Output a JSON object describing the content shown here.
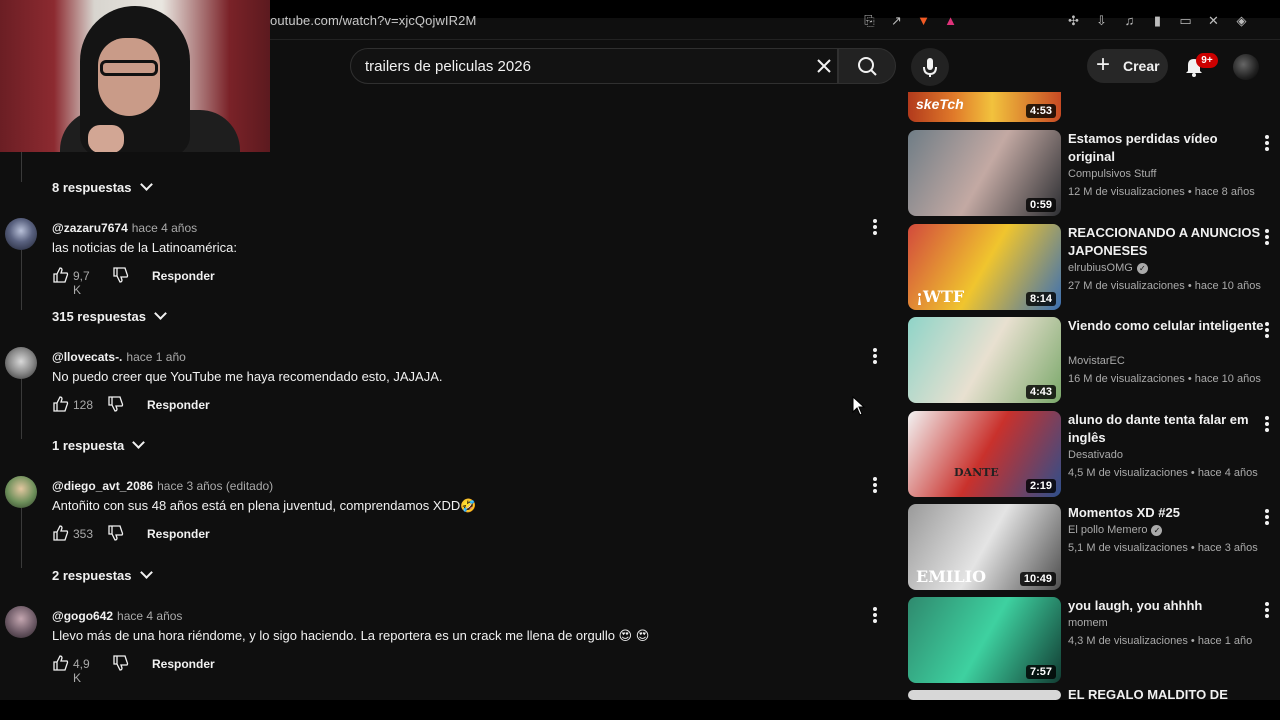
{
  "browser": {
    "url": "outube.com/watch?v=xjcQojwIR2M"
  },
  "header": {
    "search_value": "trailers de peliculas 2026",
    "create_label": "Crear",
    "notification_count": "9+"
  },
  "comments": [
    {
      "replies_above": "8 respuestas"
    },
    {
      "user": "@zazaru7674",
      "time": "hace 4 años",
      "text": "las noticias de la Latinoamérica:",
      "likes": "9,7 K",
      "reply_label": "Responder",
      "replies": "315 respuestas"
    },
    {
      "user": "@llovecats-.",
      "time": "hace 1 año",
      "text": "No puedo creer que YouTube me haya recomendado esto, JAJAJA.",
      "likes": "128",
      "reply_label": "Responder",
      "replies": "1 respuesta"
    },
    {
      "user": "@diego_avt_2086",
      "time": "hace 3 años (editado)",
      "text": "Antoñito con sus 48 años está en plena juventud, comprendamos XDD🤣",
      "likes": "353",
      "reply_label": "Responder",
      "replies": "2 respuestas"
    },
    {
      "user": "@gogo642",
      "time": "hace 4 años",
      "text": "Llevo más de una hora riéndome, y lo sigo haciendo. La reportera es un crack me llena de orgullo 😍 😍",
      "likes": "4,9 K",
      "reply_label": "Responder"
    }
  ],
  "sidebar": {
    "top_partial": {
      "thumb_text": "skeTch",
      "duration": "4:53"
    },
    "videos": [
      {
        "title": "Estamos perdidas  vídeo original",
        "channel": "Compulsivos Stuff",
        "verified": false,
        "views": "12 M de visualizaciones",
        "age": "hace 8 años",
        "duration": "0:59",
        "thumb_colors": [
          "#6f7d86",
          "#c3a9a3",
          "#2d2f33"
        ]
      },
      {
        "title": "REACCIONANDO A ANUNCIOS JAPONESES",
        "channel": "elrubiusOMG",
        "verified": true,
        "views": "27 M de visualizaciones",
        "age": "hace 10 años",
        "duration": "8:14",
        "thumb_colors": [
          "#d24a3c",
          "#f0c52e",
          "#3b6fb3"
        ],
        "thumb_text": "¡WTF"
      },
      {
        "title": "Viendo como celular inteligente",
        "channel": "MovistarEC",
        "verified": false,
        "views": "16 M de visualizaciones",
        "age": "hace 10 años",
        "duration": "4:43",
        "thumb_colors": [
          "#8fd4c8",
          "#e8e0d0",
          "#7aa86a"
        ]
      },
      {
        "title": "aluno do dante tenta falar em inglês",
        "channel": "Desativado",
        "verified": false,
        "views": "4,5 M de visualizaciones",
        "age": "hace 4 años",
        "duration": "2:19",
        "thumb_colors": [
          "#f2f2f2",
          "#c9312c",
          "#2d4f8c"
        ],
        "thumb_text": "DANTE"
      },
      {
        "title": "Momentos XD #25",
        "channel": "El pollo Memero",
        "verified": true,
        "views": "5,1 M de visualizaciones",
        "age": "hace 3 años",
        "duration": "10:49",
        "thumb_colors": [
          "#9a9a9a",
          "#e4e4e4",
          "#4e4e4e"
        ],
        "thumb_text": "EMILIO"
      },
      {
        "title": "you laugh, you ahhhh",
        "channel": "momem",
        "verified": false,
        "views": "4,3 M de visualizaciones",
        "age": "hace 1 año",
        "duration": "7:57",
        "thumb_colors": [
          "#2f8a6e",
          "#3ed1a0",
          "#123d33"
        ]
      }
    ],
    "bottom_partial_title": "EL REGALO MALDITO DE"
  }
}
